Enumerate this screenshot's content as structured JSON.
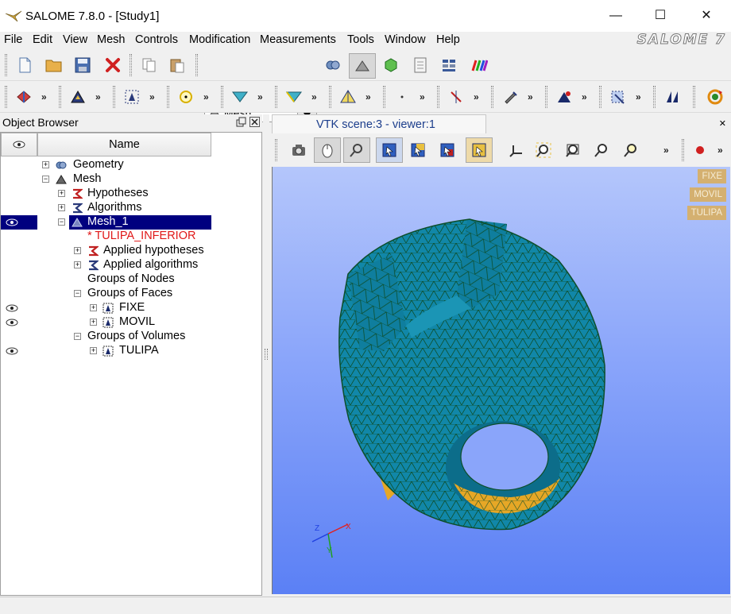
{
  "window": {
    "title": "SALOME 7.8.0 - [Study1]",
    "minimize": "—",
    "maximize": "☐",
    "close": "✕"
  },
  "menu": [
    "File",
    "Edit",
    "View",
    "Mesh",
    "Controls",
    "Modification",
    "Measurements",
    "Tools",
    "Window",
    "Help"
  ],
  "logo": "SALOME 7",
  "module_selector": {
    "value": "Mesh",
    "icon": "mesh-module-icon"
  },
  "toolbar_overflow": "»",
  "object_browser": {
    "title": "Object Browser",
    "column_visibility_icon": "eye-icon",
    "column_name": "Name",
    "tree": [
      {
        "label": "Geometry",
        "expander": "+",
        "icon": "geometry-icon"
      },
      {
        "label": "Mesh",
        "expander": "−",
        "icon": "mesh-icon"
      },
      {
        "label": "Hypotheses",
        "expander": "+",
        "icon": "hypotheses-icon"
      },
      {
        "label": "Algorithms",
        "expander": "+",
        "icon": "algorithms-icon"
      },
      {
        "label": "Mesh_1",
        "expander": "−",
        "icon": "mesh-object-icon",
        "selected": true
      },
      {
        "label": "* TULIPA_INFERIOR",
        "color": "#e01818"
      },
      {
        "label": "Applied hypotheses",
        "expander": "+",
        "icon": "hypotheses-icon"
      },
      {
        "label": "Applied algorithms",
        "expander": "+",
        "icon": "algorithms-icon"
      },
      {
        "label": "Groups of Nodes"
      },
      {
        "label": "Groups of Faces",
        "expander": "−"
      },
      {
        "label": "FIXE",
        "expander": "+",
        "icon": "group-icon",
        "visible": true
      },
      {
        "label": "MOVIL",
        "expander": "+",
        "icon": "group-icon",
        "visible": true
      },
      {
        "label": "Groups of Volumes",
        "expander": "−"
      },
      {
        "label": "TULIPA",
        "expander": "+",
        "icon": "group-icon",
        "visible": true
      }
    ]
  },
  "viewer": {
    "tab_label": "VTK scene:3 - viewer:1",
    "close": "✕",
    "group_labels": [
      "FIXE",
      "MOVIL",
      "TULIPA"
    ],
    "axis_labels": {
      "x": "X",
      "y": "Y",
      "z": "Z"
    },
    "colors": {
      "mesh_fill": "#1187a8",
      "mesh_edge": "#0d4e2a",
      "inner_fill": "#e6a726",
      "bg_top": "#b4c6fb",
      "bg_bottom": "#5b80f5"
    }
  }
}
